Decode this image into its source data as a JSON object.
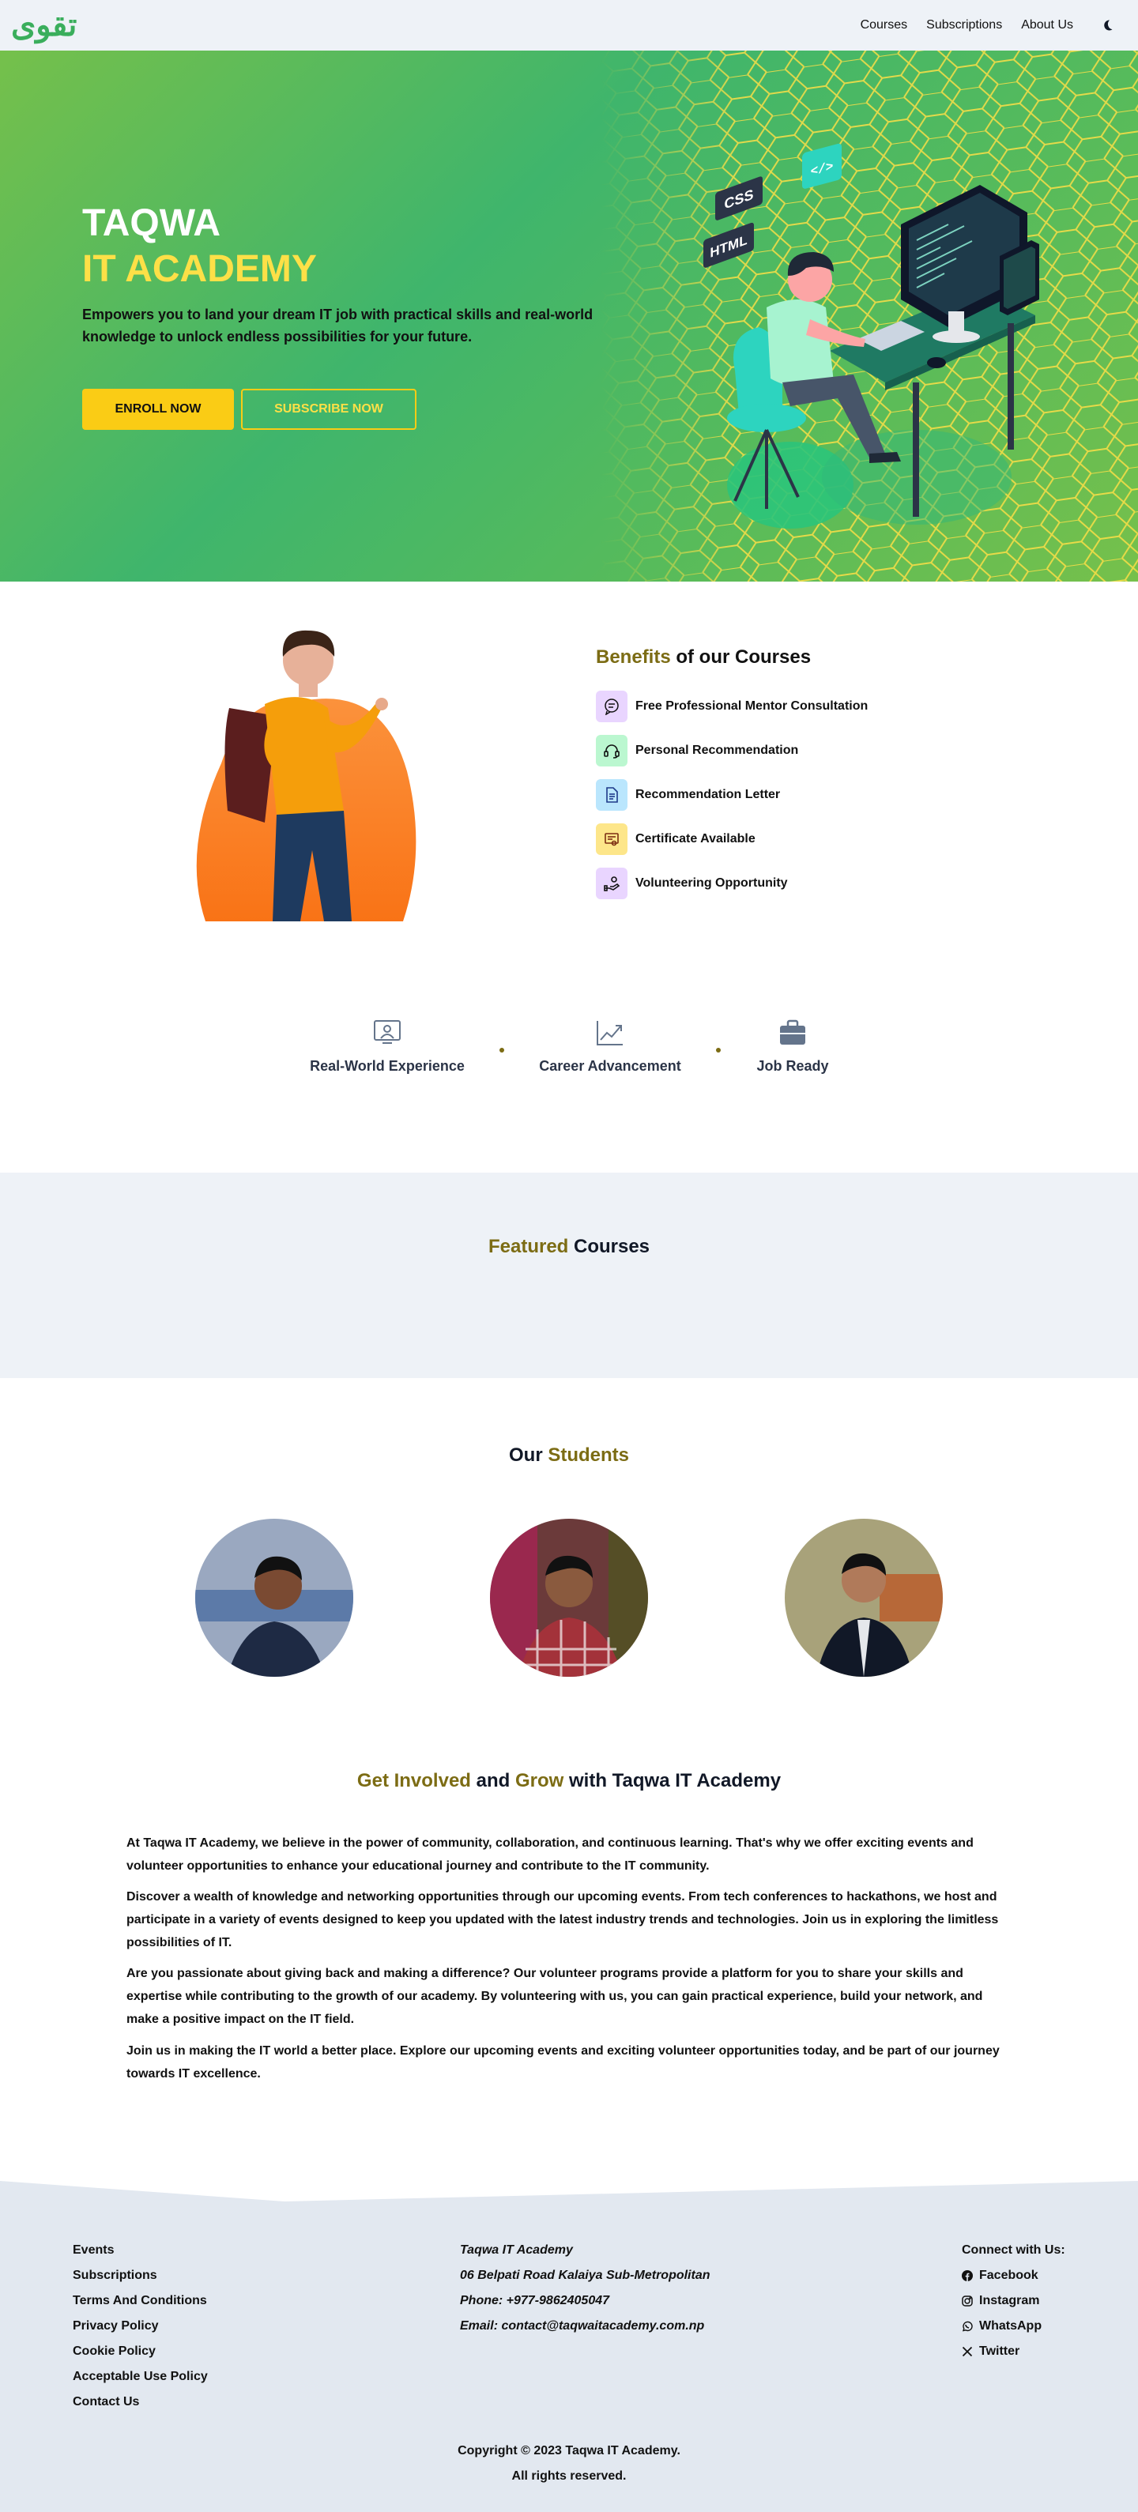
{
  "nav": {
    "logo_text": "تقوى",
    "links": [
      "Courses",
      "Subscriptions",
      "About Us"
    ],
    "theme_toggle_icon": "moon-icon"
  },
  "hero": {
    "title_line1": "TAQWA",
    "title_line2": "IT ACADEMY",
    "subtitle": "Empowers you to land your dream IT job with practical skills and real-world knowledge to unlock endless possibilities for your future.",
    "enroll_label": "ENROLL NOW",
    "subscribe_label": "SUBSCRIBE NOW",
    "illustration_labels": [
      "CSS",
      "HTML",
      "</>"
    ]
  },
  "benefits": {
    "title_accent": "Benefits",
    "title_rest": " of our Courses",
    "items": [
      {
        "label": "Free Professional Mentor Consultation",
        "icon": "chat-icon",
        "color": "#e9d5ff"
      },
      {
        "label": "Personal Recommendation",
        "icon": "headset-icon",
        "color": "#bbf7d0"
      },
      {
        "label": "Recommendation Letter",
        "icon": "document-icon",
        "color": "#bae6fd"
      },
      {
        "label": "Certificate Available",
        "icon": "certificate-icon",
        "color": "#fde68a"
      },
      {
        "label": "Volunteering Opportunity",
        "icon": "volunteer-icon",
        "color": "#e9d5ff"
      }
    ]
  },
  "features": [
    {
      "label": "Real-World Experience",
      "icon": "presentation-icon"
    },
    {
      "label": "Career Advancement",
      "icon": "trending-up-icon"
    },
    {
      "label": "Job Ready",
      "icon": "briefcase-icon"
    }
  ],
  "featured": {
    "title_accent": "Featured",
    "title_rest": " Courses"
  },
  "students": {
    "title_plain": "Our ",
    "title_accent": "Students"
  },
  "involved": {
    "title_a": "Get Involved",
    "title_b": " and ",
    "title_c": "Grow",
    "title_d": " with Taqwa IT Academy",
    "paragraphs": [
      "At Taqwa IT Academy, we believe in the power of community, collaboration, and continuous learning. That's why we offer exciting events and volunteer opportunities to enhance your educational journey and contribute to the IT community.",
      "Discover a wealth of knowledge and networking opportunities through our upcoming events. From tech conferences to hackathons, we host and participate in a variety of events designed to keep you updated with the latest industry trends and technologies. Join us in exploring the limitless possibilities of IT.",
      "Are you passionate about giving back and making a difference? Our volunteer programs provide a platform for you to share your skills and expertise while contributing to the growth of our academy. By volunteering with us, you can gain practical experience, build your network, and make a positive impact on the IT field.",
      "Join us in making the IT world a better place. Explore our upcoming events and exciting volunteer opportunities today, and be part of our journey towards IT excellence."
    ]
  },
  "footer": {
    "links": [
      "Events",
      "Subscriptions",
      "Terms And Conditions",
      "Privacy Policy",
      "Cookie Policy",
      "Acceptable Use Policy",
      "Contact Us"
    ],
    "address": [
      "Taqwa IT Academy",
      "06 Belpati Road Kalaiya Sub-Metropolitan",
      "Phone: +977-9862405047",
      "Email: contact@taqwaitacademy.com.np"
    ],
    "connect_title": "Connect with Us:",
    "social": [
      {
        "label": "Facebook",
        "icon": "facebook-icon"
      },
      {
        "label": "Instagram",
        "icon": "instagram-icon"
      },
      {
        "label": "WhatsApp",
        "icon": "whatsapp-icon"
      },
      {
        "label": "Twitter",
        "icon": "x-twitter-icon"
      }
    ],
    "copyright": "Copyright © 2023 Taqwa IT Academy.",
    "rights": "All rights reserved."
  },
  "colors": {
    "accent_olive": "#7c6c14",
    "hero_yellow": "#fde047",
    "button_yellow": "#facc15",
    "hero_green": "#3fb56c",
    "footer_bg": "#e2e8f0"
  }
}
